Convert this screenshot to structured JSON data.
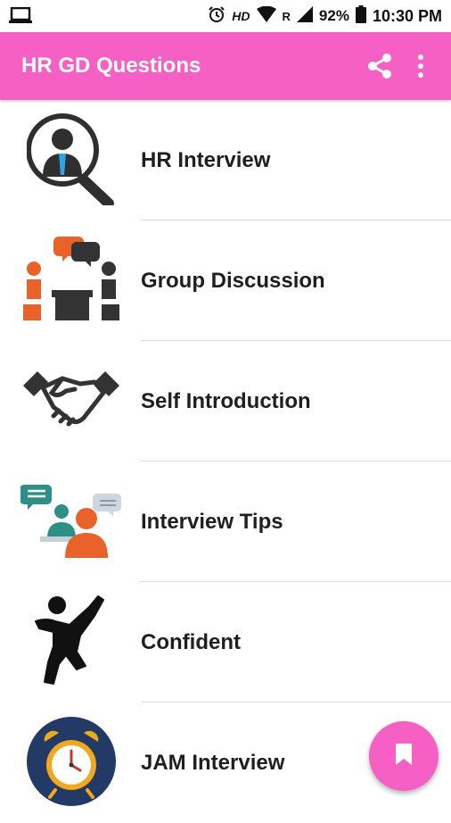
{
  "status_bar": {
    "hd": "HD",
    "roaming": "R",
    "battery": "92%",
    "time": "10:30 PM"
  },
  "app_bar": {
    "title": "HR GD Questions",
    "icons": [
      "share-icon",
      "more-vert-icon"
    ]
  },
  "colors": {
    "accent": "#f65fc4",
    "text": "#1f1f1f",
    "divider": "#dcdcdc"
  },
  "list": {
    "items": [
      {
        "label": "HR Interview",
        "icon": "hr-interview-icon"
      },
      {
        "label": "Group Discussion",
        "icon": "group-discussion-icon"
      },
      {
        "label": "Self Introduction",
        "icon": "handshake-icon"
      },
      {
        "label": "Interview Tips",
        "icon": "interview-tips-icon"
      },
      {
        "label": "Confident",
        "icon": "confident-person-icon"
      },
      {
        "label": "JAM Interview",
        "icon": "alarm-clock-icon"
      }
    ]
  },
  "fab": {
    "icon": "bookmark-icon"
  }
}
